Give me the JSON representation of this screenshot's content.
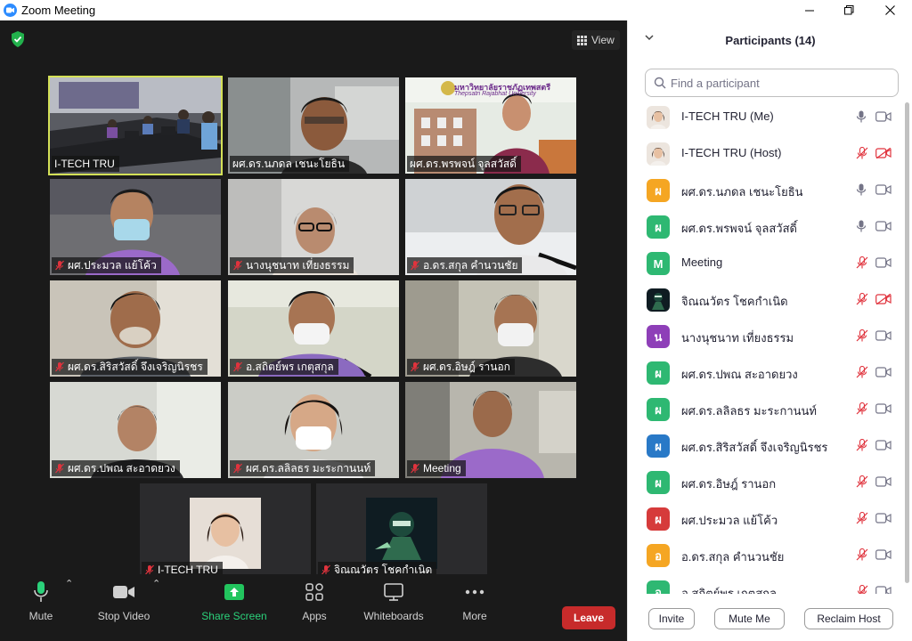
{
  "window": {
    "title": "Zoom Meeting"
  },
  "meeting": {
    "view_label": "View",
    "tiles": [
      {
        "name": "I-TECH TRU",
        "muted": false,
        "active": true
      },
      {
        "name": "ผศ.ดร.นภดล เชนะโยธิน",
        "muted": false,
        "active": false
      },
      {
        "name": "ผศ.ดร.พรพจน์ จุลสวัสดิ์",
        "muted": false,
        "active": false
      },
      {
        "name": "ผศ.ประมวล แย้โค้ว",
        "muted": true,
        "active": false
      },
      {
        "name": "นางนุชนาท เที่ยงธรรม",
        "muted": true,
        "active": false
      },
      {
        "name": "อ.ดร.สกุล คำนวนชัย",
        "muted": true,
        "active": false
      },
      {
        "name": "ผศ.ดร.สิริสวัสดิ์ จึงเจริญนิรชร",
        "muted": true,
        "active": false
      },
      {
        "name": "อ.สถิตย์พร เกตุสกุล",
        "muted": true,
        "active": false
      },
      {
        "name": "ผศ.ดร.อิษฎ์ รานอก",
        "muted": true,
        "active": false
      },
      {
        "name": "ผศ.ดร.ปพณ สะอาดยวง",
        "muted": true,
        "active": false
      },
      {
        "name": "ผศ.ดร.ลลิลธร มะระกานนท์",
        "muted": true,
        "active": false
      },
      {
        "name": "Meeting",
        "muted": true,
        "active": false
      },
      {
        "name": "I-TECH TRU",
        "muted": true,
        "active": false
      },
      {
        "name": "จิณณวัตร โชคกำเนิด",
        "muted": true,
        "active": false
      }
    ],
    "banner": {
      "univ_thai": "มหาวิทยาลัยราชภัฏเทพสตรี",
      "univ_en": "Thepsatri Rajabhat University"
    }
  },
  "toolbar": {
    "mute": "Mute",
    "stop_video": "Stop Video",
    "share_screen": "Share Screen",
    "apps": "Apps",
    "whiteboards": "Whiteboards",
    "more": "More",
    "leave": "Leave"
  },
  "panel": {
    "title": "Participants (14)",
    "search_placeholder": "Find a participant",
    "participants": [
      {
        "name": "I-TECH TRU (Me)",
        "avatar": "photo-woman",
        "mic_muted": false,
        "cam_off": false
      },
      {
        "name": "I-TECH TRU (Host)",
        "avatar": "photo-woman",
        "mic_muted": true,
        "cam_off": true
      },
      {
        "name": "ผศ.ดร.นภดล เชนะโยธิน",
        "initial": "ผ",
        "color": "#f5a623",
        "mic_muted": false,
        "cam_off": false
      },
      {
        "name": "ผศ.ดร.พรพจน์ จุลสวัสดิ์",
        "initial": "ผ",
        "color": "#2eb872",
        "mic_muted": false,
        "cam_off": false
      },
      {
        "name": "Meeting",
        "initial": "M",
        "color": "#2eb872",
        "mic_muted": true,
        "cam_off": false
      },
      {
        "name": "จิณณวัตร โชคกำเนิด",
        "avatar": "photo-game",
        "mic_muted": true,
        "cam_off": true
      },
      {
        "name": "นางนุชนาท เที่ยงธรรม",
        "initial": "น",
        "color": "#8e3fb8",
        "mic_muted": true,
        "cam_off": false
      },
      {
        "name": "ผศ.ดร.ปพณ สะอาดยวง",
        "initial": "ผ",
        "color": "#2eb872",
        "mic_muted": true,
        "cam_off": false
      },
      {
        "name": "ผศ.ดร.ลลิลธร มะระกานนท์",
        "initial": "ผ",
        "color": "#2eb872",
        "mic_muted": true,
        "cam_off": false
      },
      {
        "name": "ผศ.ดร.สิริสวัสดิ์ จึงเจริญนิรชร",
        "initial": "ผ",
        "color": "#2979c7",
        "mic_muted": true,
        "cam_off": false
      },
      {
        "name": "ผศ.ดร.อิษฎ์ รานอก",
        "initial": "ผ",
        "color": "#2eb872",
        "mic_muted": true,
        "cam_off": false
      },
      {
        "name": "ผศ.ประมวล แย้โค้ว",
        "initial": "ผ",
        "color": "#d63b3b",
        "mic_muted": true,
        "cam_off": false
      },
      {
        "name": "อ.ดร.สกุล คำนวนชัย",
        "initial": "อ",
        "color": "#f5a623",
        "mic_muted": true,
        "cam_off": false
      },
      {
        "name": "อ.สถิตย์พร เกตุสกุล",
        "initial": "อ",
        "color": "#2eb872",
        "mic_muted": true,
        "cam_off": false
      }
    ],
    "invite": "Invite",
    "mute_me": "Mute Me",
    "reclaim_host": "Reclaim Host"
  },
  "colors": {
    "accent_blue": "#2d8cff",
    "active_speaker": "#d4e157",
    "leave_red": "#c72b2b",
    "share_green": "#22c55e",
    "muted_red": "#e0333d"
  }
}
